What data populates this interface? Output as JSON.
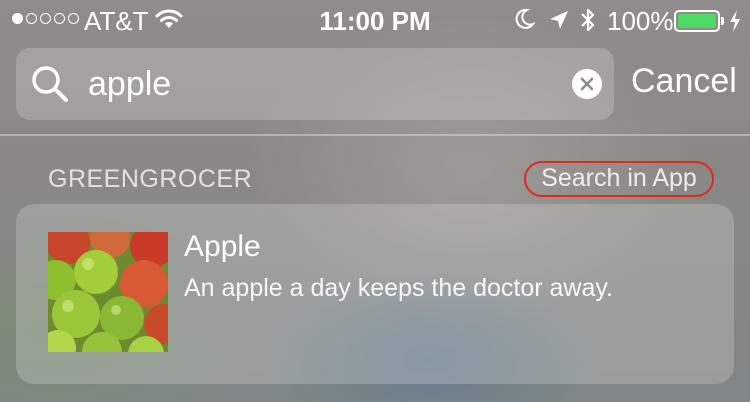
{
  "status_bar": {
    "carrier": "AT&T",
    "time": "11:00 PM",
    "battery_percent": "100%",
    "signal_bars": {
      "filled": 1,
      "total": 5
    },
    "battery_level": 1.0,
    "battery_color": "#4cd964",
    "icons": [
      "wifi-icon",
      "moon-icon",
      "location-arrow-icon",
      "bluetooth-icon",
      "battery-icon",
      "charging-bolt-icon"
    ]
  },
  "search": {
    "value": "apple",
    "cancel_label": "Cancel",
    "icons": [
      "search-icon",
      "clear-icon"
    ]
  },
  "section": {
    "title": "GREENGROCER",
    "search_in_app_label": "Search in App",
    "highlight_color": "#e0281c"
  },
  "result": {
    "title": "Apple",
    "description": "An apple a day keeps the doctor away."
  }
}
